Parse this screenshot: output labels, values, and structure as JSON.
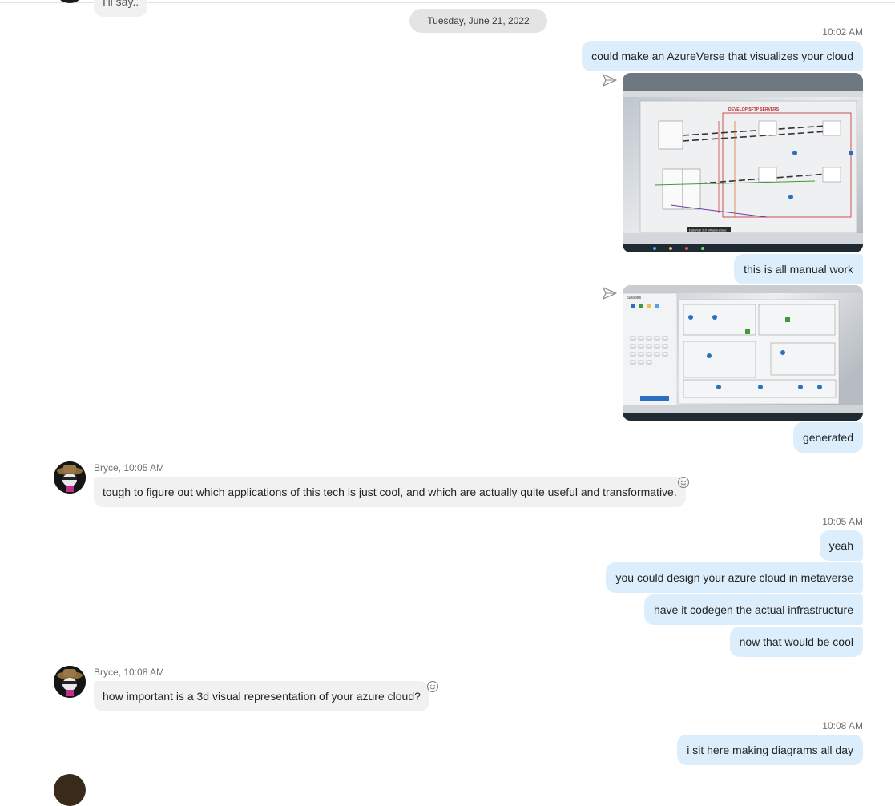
{
  "chat": {
    "partial_top_text": "I'll say..",
    "date_separator": "Tuesday, June 21, 2022",
    "groups": [
      {
        "time": "10:02 AM"
      },
      {
        "sender": "Bryce, 10:05 AM"
      },
      {
        "time": "10:05 AM"
      },
      {
        "sender": "Bryce, 10:08 AM"
      },
      {
        "time": "10:08 AM"
      }
    ],
    "outgoing": {
      "m1": "could make an AzureVerse that visualizes your cloud",
      "m2": "this is all manual work",
      "m3": "generated",
      "m4": "yeah",
      "m5": "you could design your azure cloud in metaverse",
      "m6": "have it codegen the actual infrastructure",
      "m7": "now that would be cool",
      "m8": "i sit here making diagrams all day"
    },
    "incoming": {
      "m1": "tough to figure out which applications of this tech is just cool, and which are actually quite useful and transformative.",
      "m2": "how important is a 3d visual representation of your azure cloud?"
    },
    "photo1_header": "DEVELOP SFTP SERVERS",
    "photo1_footer": "Datahub 2.0 Infrastructure",
    "photo2_panel_title": "Shapes"
  },
  "colors": {
    "outgoing_bubble": "#dceefc",
    "incoming_bubble": "#f1f1f1",
    "date_pill": "#e4e4e4",
    "meta_text": "#707070"
  }
}
